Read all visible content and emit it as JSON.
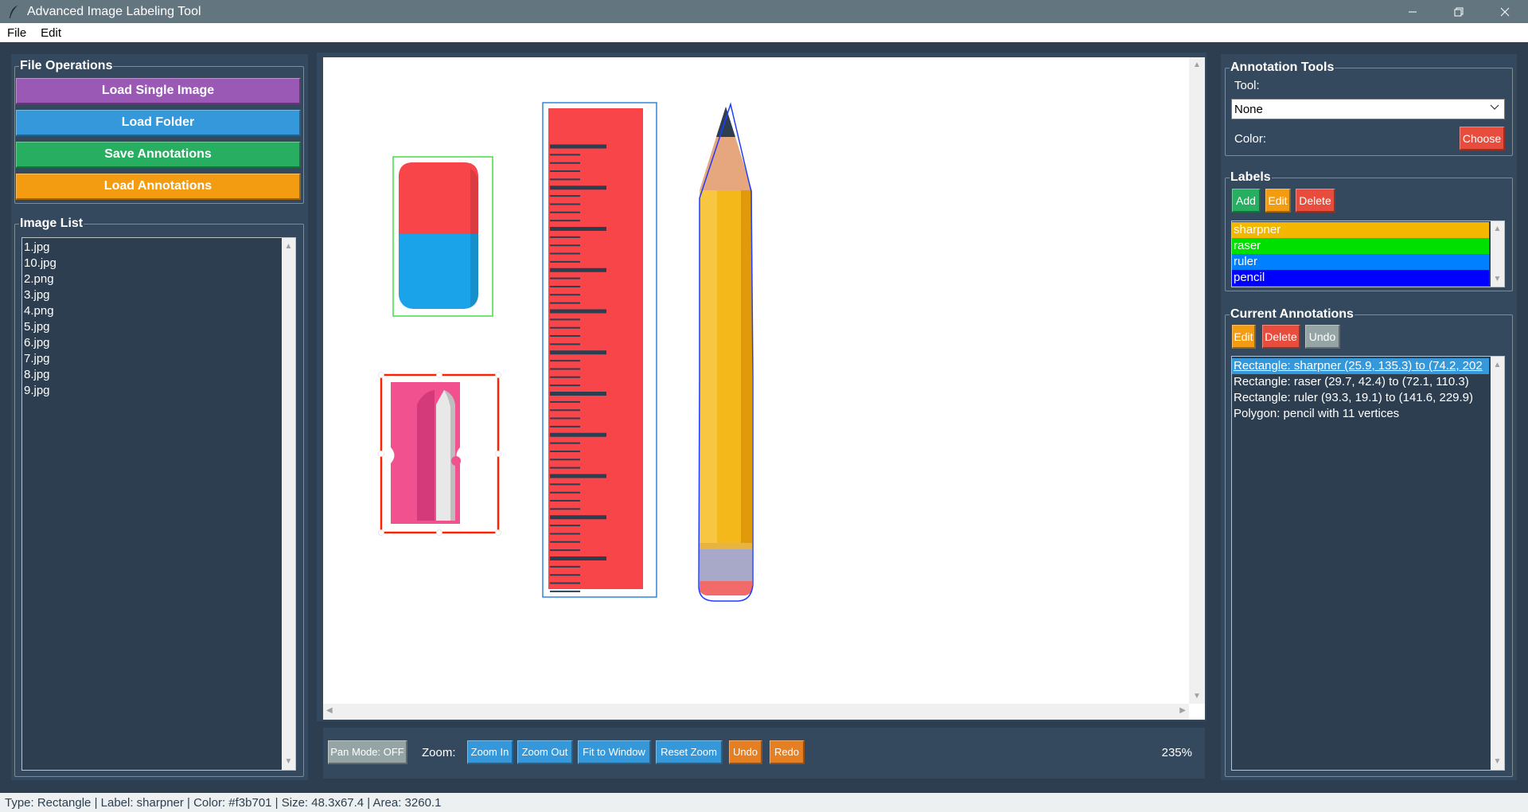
{
  "window": {
    "title": "Advanced Image Labeling Tool"
  },
  "menu": {
    "items": [
      "File",
      "Edit"
    ]
  },
  "file_ops": {
    "legend": "File Operations",
    "load_single": "Load Single Image",
    "load_folder": "Load Folder",
    "save_annotations": "Save Annotations",
    "load_annotations": "Load Annotations"
  },
  "image_list": {
    "legend": "Image List",
    "items": [
      "1.jpg",
      "10.jpg",
      "2.png",
      "3.jpg",
      "4.png",
      "5.jpg",
      "6.jpg",
      "7.jpg",
      "8.jpg",
      "9.jpg"
    ]
  },
  "annotation_tools": {
    "legend": "Annotation Tools",
    "tool_label": "Tool:",
    "tool_value": "None",
    "color_label": "Color:",
    "choose": "Choose"
  },
  "labels": {
    "legend": "Labels",
    "add": "Add",
    "edit": "Edit",
    "delete": "Delete",
    "items": [
      {
        "name": "sharpner",
        "color": "#f3b701"
      },
      {
        "name": "raser",
        "color": "#00e000"
      },
      {
        "name": "ruler",
        "color": "#0080ff"
      },
      {
        "name": "pencil",
        "color": "#0000ff"
      }
    ]
  },
  "current_annotations": {
    "legend": "Current Annotations",
    "edit": "Edit",
    "delete": "Delete",
    "undo": "Undo",
    "items": [
      "Rectangle: sharpner (25.9, 135.3) to (74.2, 202",
      "Rectangle: raser (29.7, 42.4) to (72.1, 110.3)",
      "Rectangle: ruler (93.3, 19.1) to (141.6, 229.9)",
      "Polygon: pencil with 11 vertices"
    ],
    "selected_index": 0
  },
  "toolbar": {
    "pan_mode": "Pan Mode: OFF",
    "zoom_label": "Zoom:",
    "zoom_in": "Zoom In",
    "zoom_out": "Zoom Out",
    "fit_window": "Fit to Window",
    "reset_zoom": "Reset Zoom",
    "undo": "Undo",
    "redo": "Redo",
    "zoom_level": "235%"
  },
  "status": {
    "text": "Type: Rectangle | Label: sharpner | Color: #f3b701 | Size: 48.3x67.4 | Area: 3260.1"
  },
  "colors": {
    "purple": "#9b59b6",
    "blue": "#3498db",
    "green": "#27ae60",
    "orange": "#f39c12",
    "red": "#e74c3c",
    "gray": "#95a5a6"
  }
}
